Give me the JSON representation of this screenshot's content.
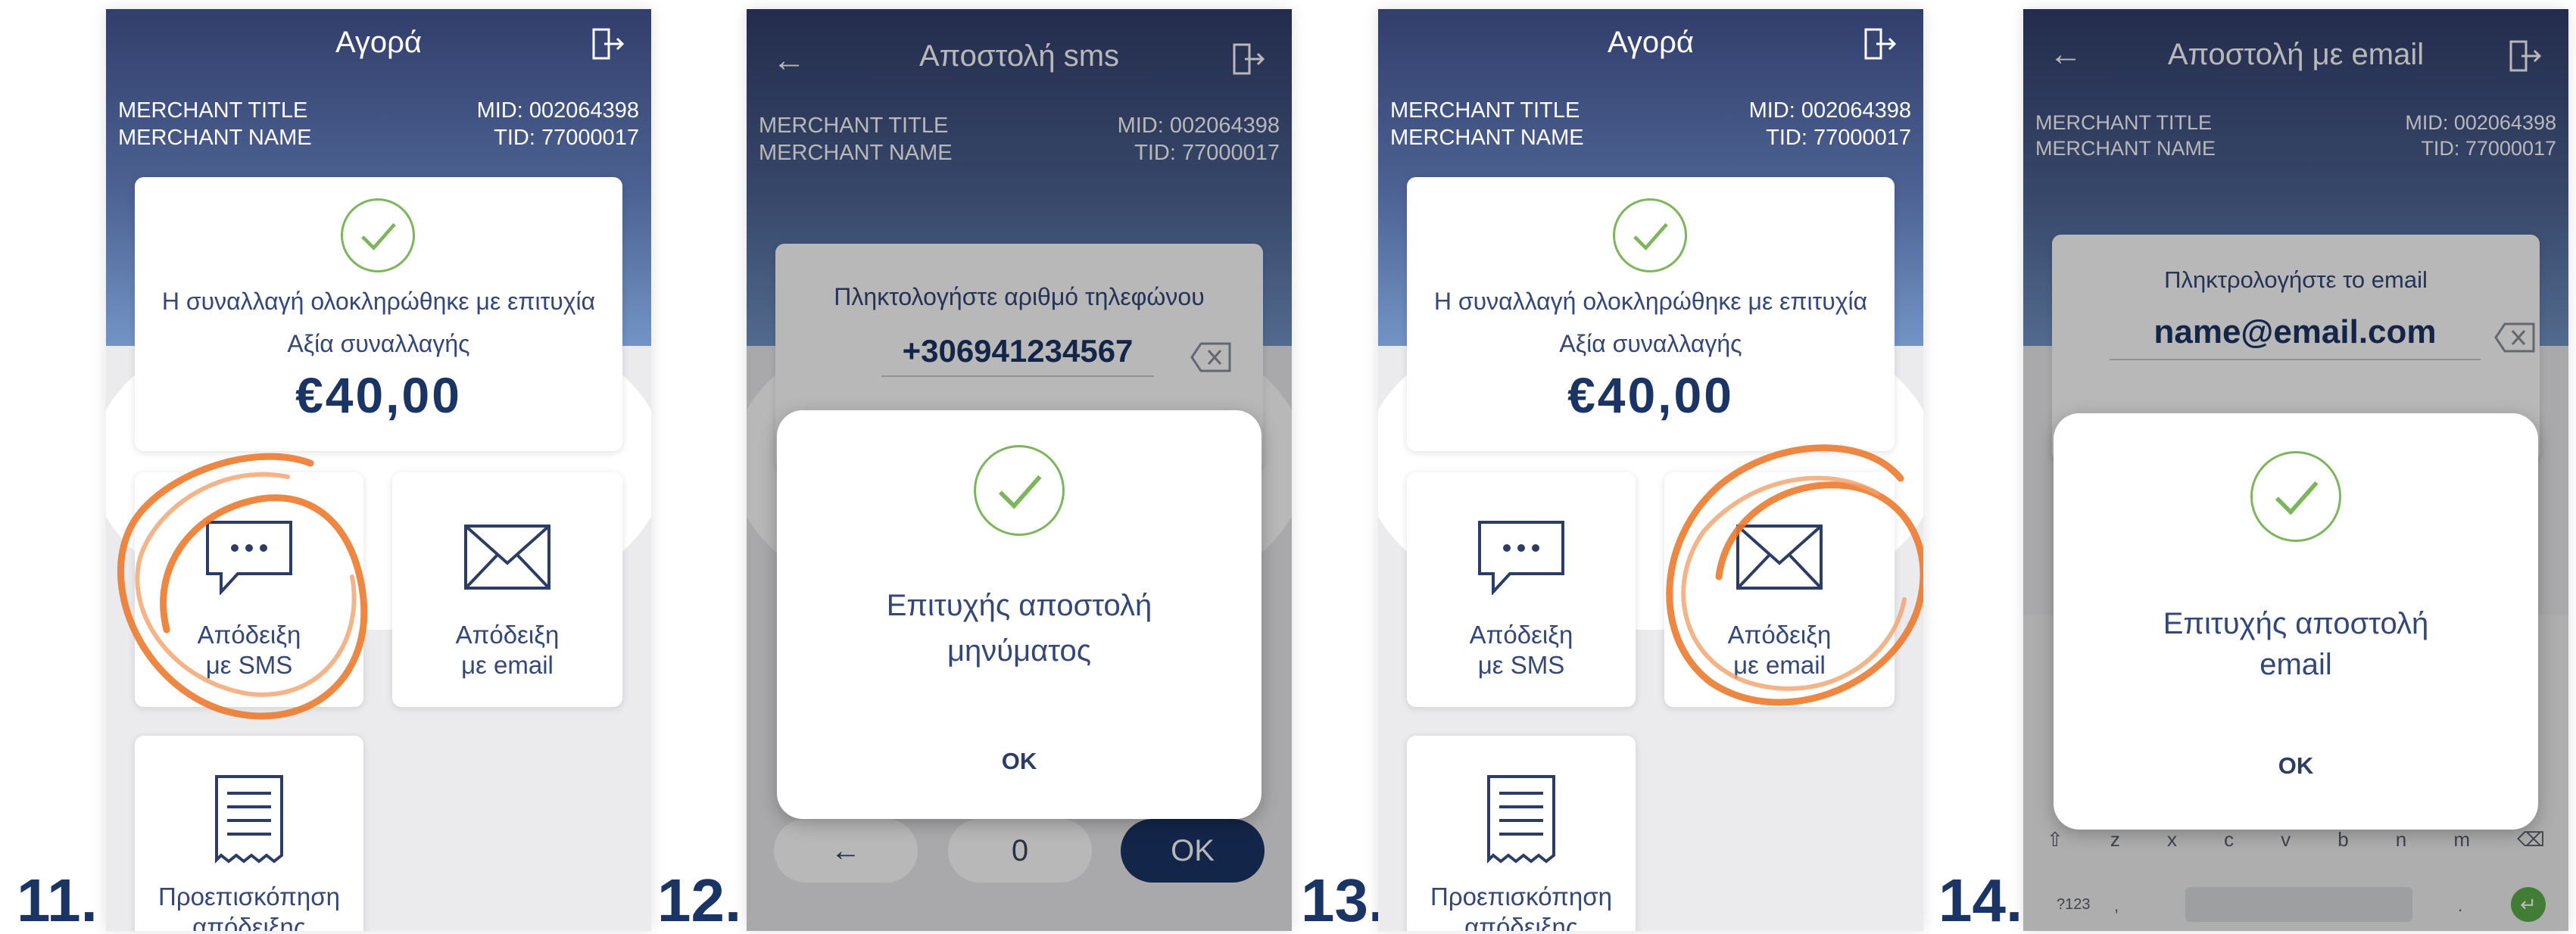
{
  "steps": [
    "11.",
    "12.",
    "13.",
    "14."
  ],
  "merchant": {
    "title": "MERCHANT TITLE",
    "name": "MERCHANT NAME",
    "mid": "MID: 002064398",
    "tid": "TID: 77000017"
  },
  "purchase": {
    "title": "Αγορά",
    "success_message": "Η συναλλαγή ολοκληρώθηκε με επιτυχία",
    "amount_label": "Αξία συναλλαγής",
    "amount": "€40,00",
    "sms_receipt": [
      "Απόδειξη",
      "με SMS"
    ],
    "email_receipt": [
      "Απόδειξη",
      "με email"
    ],
    "preview_receipt": [
      "Προεπισκόπηση",
      "απόδειξης"
    ]
  },
  "sms": {
    "title": "Αποστολή sms",
    "prompt": "Πληκτολογήστε αριθμό τηλεφώνου",
    "phone_value": "+306941234567",
    "dialog_message": [
      "Επιτυχής αποστολή",
      "μηνύματος"
    ],
    "ok": "OK",
    "keypad_back": "←",
    "keypad_zero": "0",
    "keypad_ok": "OK"
  },
  "email": {
    "title": "Αποστολή με email",
    "prompt": "Πληκτρολογήστε το email",
    "email_value": "name@email.com",
    "dialog_message": [
      "Επιτυχής αποστολή",
      "email"
    ],
    "ok": "OK",
    "keyboard_row": [
      "⇧",
      "z",
      "x",
      "c",
      "v",
      "b",
      "n",
      "m",
      "⌫"
    ],
    "keyboard_symbols": "?123",
    "keyboard_comma": ",",
    "keyboard_period": "."
  },
  "colors": {
    "navy": "#1b3466",
    "header_top": "#323e6c",
    "header_bottom": "#7294c5",
    "success_green": "#7bb65a",
    "highlight_orange": "#ec7a2e",
    "text_blue": "#34477a"
  }
}
